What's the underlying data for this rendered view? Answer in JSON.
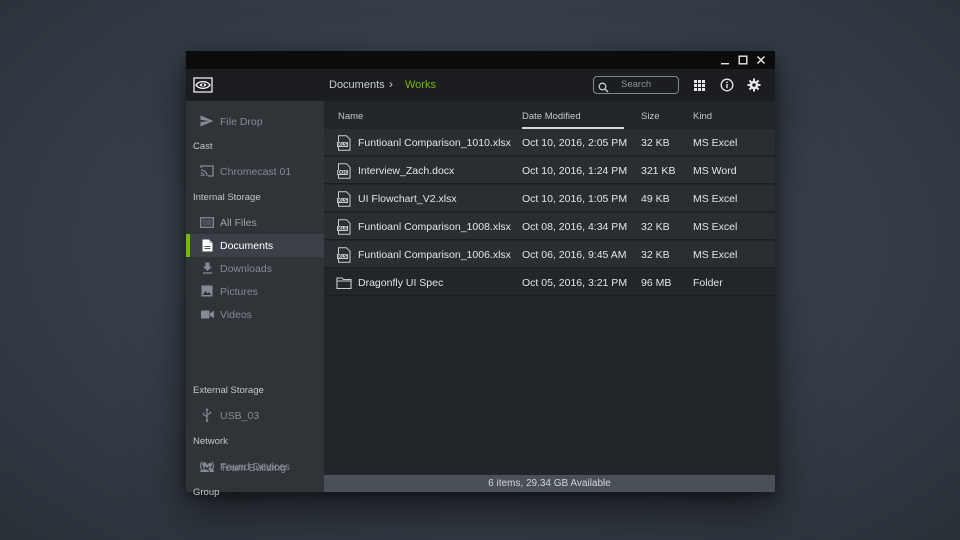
{
  "window": {
    "controls": {
      "minimize": "minimize-icon",
      "maximize": "maximize-icon",
      "close": "close-icon"
    }
  },
  "header": {
    "logo": "nvidia-eye-logo",
    "breadcrumb": [
      "Documents",
      "Works"
    ],
    "breadcrumb_separator": "›",
    "search_placeholder": "Search",
    "icons": [
      "grid-view-icon",
      "info-icon",
      "gear-icon"
    ],
    "accent_color": "#76b900"
  },
  "sidebar": {
    "top_items": [
      {
        "label": "File Drop",
        "icon": "send-icon"
      }
    ],
    "sections": [
      {
        "title": "Cast",
        "items": [
          {
            "label": "Chromecast 01",
            "icon": "cast-icon"
          }
        ]
      },
      {
        "title": "Internal Storage",
        "items": [
          {
            "label": "All Files",
            "icon": "tablet-icon"
          },
          {
            "label": "Documents",
            "icon": "document-icon",
            "active": true
          },
          {
            "label": "Downloads",
            "icon": "download-icon"
          },
          {
            "label": "Pictures",
            "icon": "image-icon"
          },
          {
            "label": "Videos",
            "icon": "video-icon"
          }
        ]
      },
      {
        "title": "External Storage",
        "items": [
          {
            "label": "USB_03",
            "icon": "usb-icon"
          }
        ]
      },
      {
        "title": "Network",
        "items": [
          {
            "label": "Found Devices",
            "icon": "broadcast-icon"
          }
        ]
      },
      {
        "title": "Group",
        "items": [
          {
            "label": "Team Building",
            "icon": "people-icon"
          }
        ]
      }
    ]
  },
  "table": {
    "columns": [
      "Name",
      "Date Modified",
      "Size",
      "Kind"
    ],
    "sorted_by": "Date Modified",
    "rows": [
      {
        "name": "Funtioanl Comparison_1010.xlsx",
        "date": "Oct 10, 2016, 2:05 PM",
        "size": "32 KB",
        "kind": "MS Excel",
        "icon": "xls-file-icon"
      },
      {
        "name": "Interview_Zach.docx",
        "date": "Oct 10, 2016, 1:24 PM",
        "size": "321 KB",
        "kind": "MS Word",
        "icon": "doc-file-icon"
      },
      {
        "name": "UI Flowchart_V2.xlsx",
        "date": "Oct 10, 2016, 1:05 PM",
        "size": "49 KB",
        "kind": "MS Excel",
        "icon": "xls-file-icon"
      },
      {
        "name": "Funtioanl Comparison_1008.xlsx",
        "date": "Oct 08, 2016, 4:34 PM",
        "size": "32 KB",
        "kind": "MS Excel",
        "icon": "xls-file-icon"
      },
      {
        "name": "Funtioanl Comparison_1006.xlsx",
        "date": "Oct 06, 2016, 9:45 AM",
        "size": "32 KB",
        "kind": "MS Excel",
        "icon": "xls-file-icon"
      },
      {
        "name": "Dragonfly UI Spec",
        "date": "Oct 05, 2016, 3:21 PM",
        "size": "96 MB",
        "kind": "Folder",
        "icon": "folder-icon"
      }
    ]
  },
  "status": {
    "text": "6 items, 29.34 GB Available"
  }
}
